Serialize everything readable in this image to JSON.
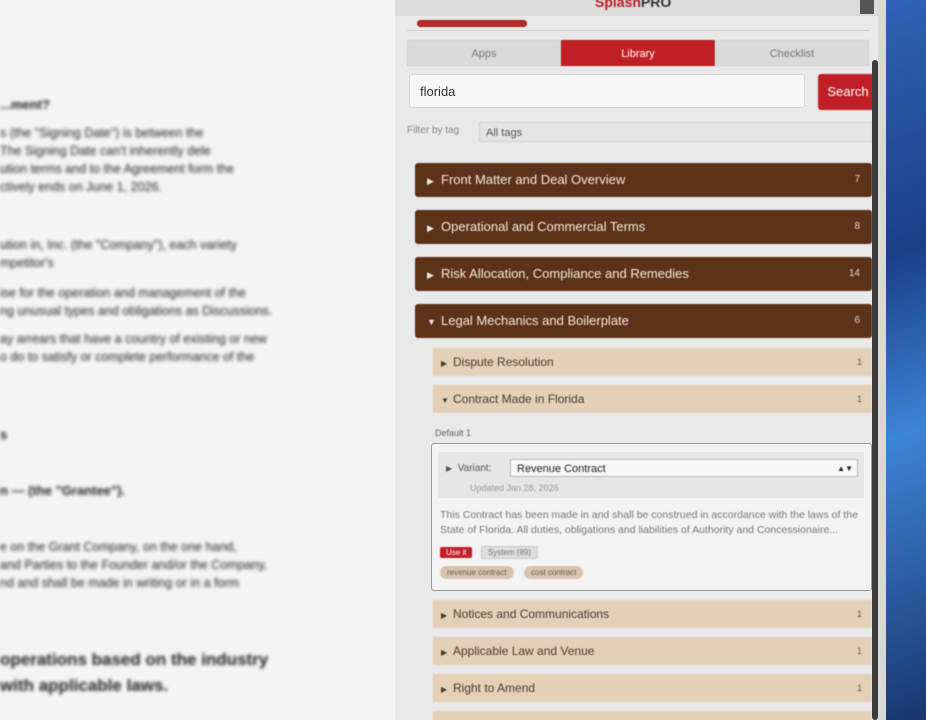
{
  "document": {
    "lines": [
      "...ment?",
      "s (the \"Signing Date\") is between the",
      "The Signing Date can't inherently dele",
      "ution terms and to the Agreement form the",
      "ctively ends on June 1, 2026.",
      "ution in, Inc. (the \"Company\"), each variety",
      "mpetitor's",
      "ise for the operation and management of the",
      "ng unusual types and obligations as Discussions.",
      "ay arrears that have a country of existing or new",
      "o do to satisfy or complete performance of the",
      "s",
      "n — (the \"Grantee\").",
      "e on the Grant Company, on the one hand,",
      "and Parties to the Founder and/or the Company,",
      "nd and shall be made in writing or in a form",
      "operations based on the industry",
      "with applicable laws."
    ]
  },
  "panel": {
    "brand_main": "Splash",
    "brand_accent": "PRO",
    "tabs": [
      "Apps",
      "Library",
      "Checklist"
    ],
    "active_tab": "Library",
    "search": {
      "value": "florida",
      "button": "Search"
    },
    "tag_filter": {
      "label": "Filter by tag",
      "value": "All tags"
    },
    "sections": [
      {
        "title": "Front Matter and Deal Overview",
        "count": "7"
      },
      {
        "title": "Operational and Commercial Terms",
        "count": "8"
      },
      {
        "title": "Risk Allocation, Compliance and Remedies",
        "count": "14"
      },
      {
        "title": "Legal Mechanics and Boilerplate",
        "count": "6"
      }
    ],
    "subsections": [
      {
        "title": "Dispute Resolution",
        "count": "1"
      },
      {
        "title": "Contract Made in Florida",
        "count": "1"
      },
      {
        "title": "Notices and Communications",
        "count": "1"
      },
      {
        "title": "Applicable Law and Venue",
        "count": "1"
      },
      {
        "title": "Right to Amend",
        "count": "1"
      }
    ],
    "default_label": "Default 1",
    "card": {
      "variant_label": "Variant:",
      "variant_value": "Revenue Contract",
      "updated": "Updated Jan 28, 2026",
      "clause": "This Contract has been made in and shall be construed in accordance with the laws of the State of Florida. All duties, obligations and liabilities of Authority and Concessionaire...",
      "chips": [
        "Use it",
        "System (89)"
      ],
      "tags": [
        "revenue contract",
        "cost contract"
      ]
    }
  }
}
